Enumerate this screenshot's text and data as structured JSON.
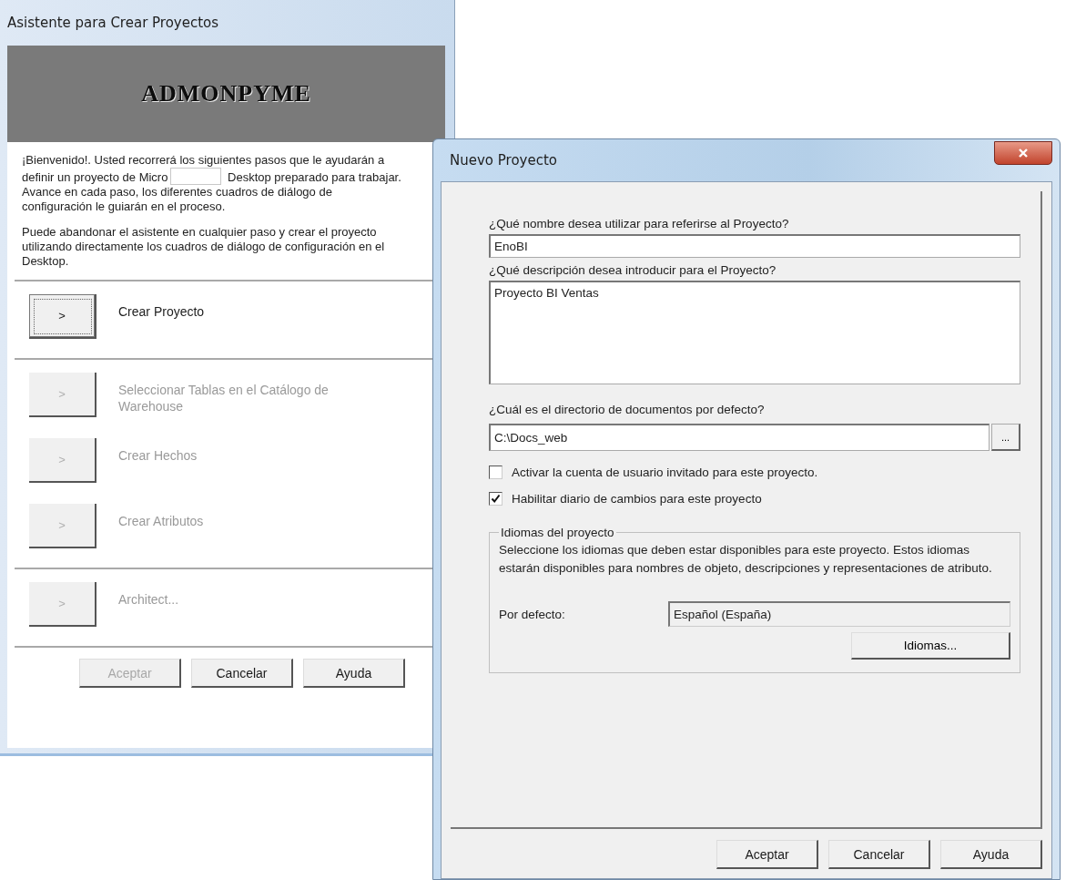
{
  "wizard": {
    "title": "Asistente para Crear Proyectos",
    "banner": "ADMONPYME",
    "welcome": {
      "before": "¡Bienvenido!. Usted recorrerá los siguientes pasos que le ayudarán a definir un proyecto de Micro",
      "after": "Desktop preparado para trabajar. Avance en cada paso, los diferentes cuadros de diálogo de configuración le guiarán en el proceso."
    },
    "note": "Puede abandonar el asistente en cualquier paso y crear el proyecto utilizando directamente los cuadros de diálogo de configuración en el Desktop.",
    "step_groups": [
      {
        "steps": [
          {
            "arrow": ">",
            "label": "Crear Proyecto",
            "disabled": false
          }
        ]
      },
      {
        "steps": [
          {
            "arrow": ">",
            "label": "Seleccionar Tablas en el Catálogo de Warehouse",
            "disabled": true
          },
          {
            "arrow": ">",
            "label": "Crear Hechos",
            "disabled": true
          },
          {
            "arrow": ">",
            "label": "Crear Atributos",
            "disabled": true
          }
        ]
      },
      {
        "steps": [
          {
            "arrow": ">",
            "label": "Architect...",
            "disabled": true
          }
        ]
      }
    ],
    "buttons": [
      {
        "label": "Aceptar",
        "disabled": true
      },
      {
        "label": "Cancelar",
        "disabled": false
      },
      {
        "label": "Ayuda",
        "disabled": false
      }
    ]
  },
  "dialog": {
    "title": "Nuevo Proyecto",
    "name_label": "¿Qué nombre desea utilizar para referirse al Proyecto?",
    "name_value": "EnoBI",
    "description_label": "¿Qué descripción desea introducir para el Proyecto?",
    "description_value": "Proyecto BI Ventas",
    "directory_label": "¿Cuál es el directorio de documentos por defecto?",
    "directory_value": "C:\\Docs_web",
    "browse_button": "...",
    "options": [
      {
        "label": "Activar la cuenta de usuario invitado para este proyecto.",
        "checked": false
      },
      {
        "label": "Habilitar diario de cambios para este proyecto",
        "checked": true
      }
    ],
    "languages": {
      "legend": "Idiomas del proyecto",
      "description": "Seleccione los idiomas que deben estar disponibles para este proyecto. Estos idiomas estarán disponibles para nombres de objeto, descripciones y representaciones de atributo.",
      "default_label": "Por defecto:",
      "default_value": "Español (España)",
      "button": "Idiomas..."
    },
    "buttons": [
      {
        "label": "Aceptar",
        "disabled": false
      },
      {
        "label": "Cancelar",
        "disabled": false
      },
      {
        "label": "Ayuda",
        "disabled": false
      }
    ]
  }
}
